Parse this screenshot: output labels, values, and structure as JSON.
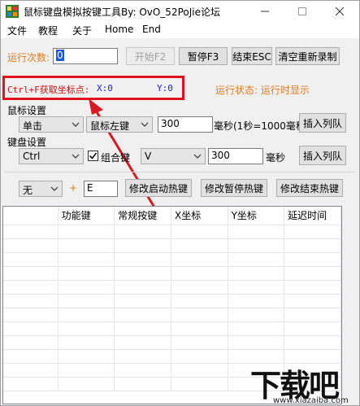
{
  "window": {
    "title": "鼠标键盘模拟按键工具By:  OvO_52PoJie论坛",
    "controls": {
      "minimize": "—",
      "maximize": "☐",
      "close": "✕"
    }
  },
  "menu": [
    {
      "label": "文件"
    },
    {
      "label": "教程"
    },
    {
      "label": "关于"
    },
    {
      "label": "Home"
    },
    {
      "label": "End"
    }
  ],
  "run_row": {
    "count_label": "运行次数:",
    "count_value": "0",
    "start_button": "开始F2",
    "pause_button": "暂停F3",
    "end_button": "结束ESC",
    "clear_button": "清空重新录制"
  },
  "coords": {
    "hint": "Ctrl+F获取坐标点:",
    "x_label": "X:0",
    "y_label": "Y:0",
    "status_label": "运行状态: 运行时显示"
  },
  "mouse": {
    "section_label": "鼠标设置",
    "action_value": "单击",
    "button_value": "鼠标左键",
    "delay_value": "300",
    "delay_hint": "毫秒(1秒=1000毫秒",
    "insert_button": "插入列队"
  },
  "keyboard": {
    "section_label": "键盘设置",
    "modifier_value": "Ctrl",
    "combo_label": "组合键",
    "combo_checked": true,
    "key_value": "V",
    "delay_value": "300",
    "delay_unit": "毫秒",
    "insert_button": "插入列队"
  },
  "hotkeys": {
    "modifier_value": "无",
    "plus": "+",
    "key_value": "E",
    "start_button": "修改启动热键",
    "pause_button": "修改暂停热键",
    "end_button": "修改结束热键"
  },
  "table": {
    "columns": [
      "",
      "功能键",
      "常规按键",
      "X坐标",
      "Y坐标",
      "延迟时间"
    ]
  },
  "watermark": {
    "brand": "下载吧",
    "url": "www.xiazaiba.com"
  },
  "colors": {
    "highlight": "#e0121b",
    "status_orange": "#e07b1e",
    "coord_blue": "#1a1aff"
  }
}
